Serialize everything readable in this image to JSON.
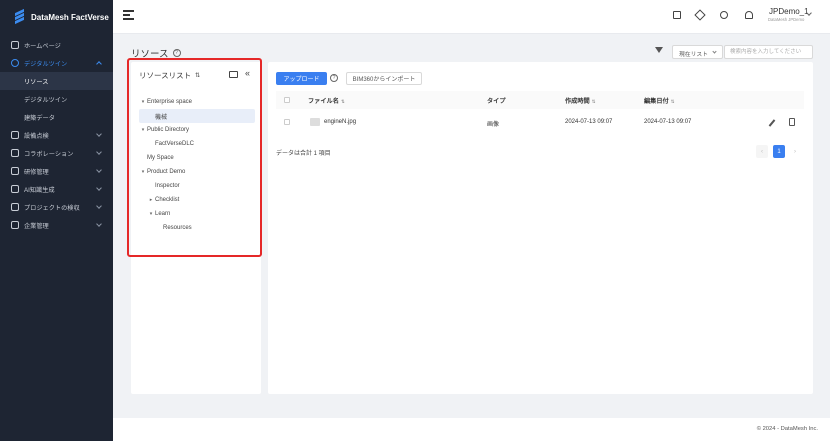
{
  "app": {
    "name": "DataMesh FactVerse"
  },
  "sidebar": {
    "items": [
      {
        "label": "ホームページ"
      },
      {
        "label": "デジタルツイン"
      },
      {
        "label": "設備点検"
      },
      {
        "label": "コラボレーション"
      },
      {
        "label": "研修管理"
      },
      {
        "label": "AI知識生成"
      },
      {
        "label": "プロジェクトの検収"
      },
      {
        "label": "企業管理"
      }
    ],
    "submenu": [
      {
        "label": "リソース"
      },
      {
        "label": "デジタルツイン"
      },
      {
        "label": "建築データ"
      }
    ]
  },
  "header": {
    "user_name": "JPDemo_1",
    "user_sub": "DataMesh JPDemo"
  },
  "page": {
    "title": "リソース",
    "scope_select": "現在リスト",
    "search_placeholder": "検索内容を入力してください"
  },
  "resource_list": {
    "title": "リソースリスト",
    "tree": [
      {
        "label": "Enterprise space"
      },
      {
        "label": "機械"
      },
      {
        "label": "Public Directory"
      },
      {
        "label": "FactVerseDLC"
      },
      {
        "label": "My Space"
      },
      {
        "label": "Product Demo"
      },
      {
        "label": "Inspector"
      },
      {
        "label": "Checklist"
      },
      {
        "label": "Learn"
      },
      {
        "label": "Resources"
      }
    ]
  },
  "toolbar": {
    "upload_label": "アップロード",
    "import_label": "BIM360からインポート"
  },
  "table": {
    "columns": [
      "ファイル名",
      "タイプ",
      "作成時間",
      "編集日付"
    ],
    "rows": [
      {
        "name": "engineN.jpg",
        "type": "画像",
        "created": "2024-07-13 09:07",
        "edited": "2024-07-13 09:07"
      }
    ],
    "total_text": "データは合計 1 項目",
    "page": "1"
  },
  "footer": {
    "copyright": "© 2024 - DataMesh Inc."
  },
  "colors": {
    "accent": "#3a7ff0",
    "sidebar_bg": "#1e2533",
    "highlight": "#e52828"
  }
}
